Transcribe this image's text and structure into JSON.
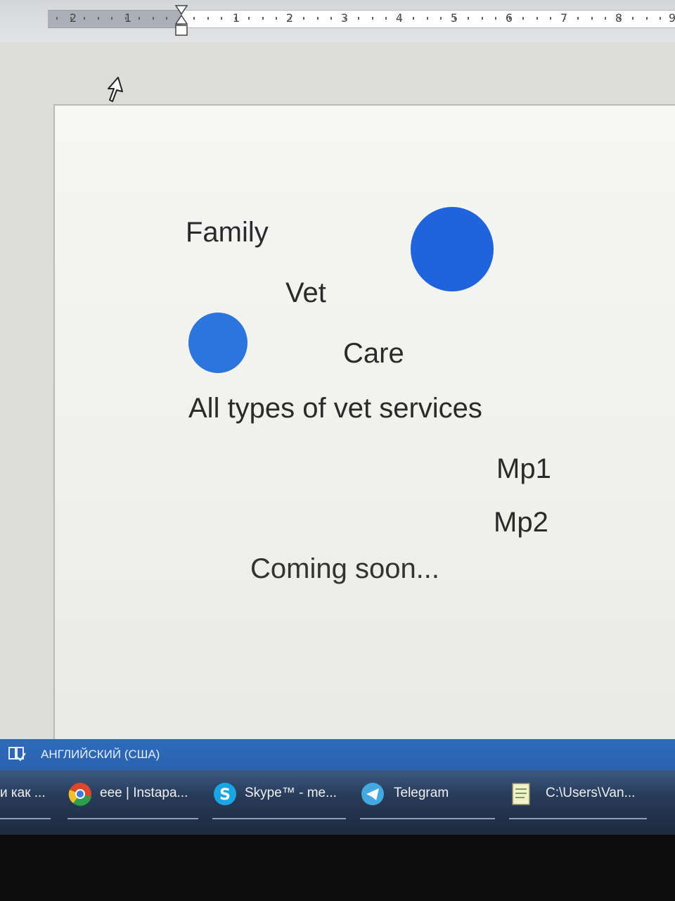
{
  "ruler": {
    "numbers": [
      "2",
      "1",
      "1",
      "2",
      "3",
      "4",
      "5",
      "6",
      "7",
      "8",
      "9"
    ]
  },
  "document": {
    "lines": [
      {
        "text": "Family"
      },
      {
        "text": "Vet"
      },
      {
        "text": "Care"
      },
      {
        "text": "All types of vet services"
      },
      {
        "text": "Mp1"
      },
      {
        "text": "Mp2"
      },
      {
        "text": "Coming soon..."
      }
    ],
    "circle_color_large": "#1f63dd",
    "circle_color_small": "#2b75dc"
  },
  "statusbar": {
    "language": "АНГЛИЙСКИЙ (США)"
  },
  "taskbar": {
    "items": [
      {
        "label": "и как ...",
        "icon": "app-icon"
      },
      {
        "label": "eee | Instapa...",
        "icon": "chrome-icon"
      },
      {
        "label": "Skype™ - me...",
        "icon": "skype-icon"
      },
      {
        "label": "Telegram",
        "icon": "telegram-icon"
      },
      {
        "label": "C:\\Users\\Van...",
        "icon": "notepad-icon"
      }
    ]
  }
}
